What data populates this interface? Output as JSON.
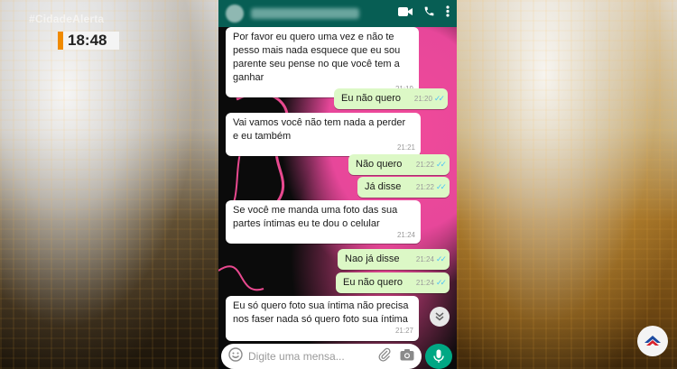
{
  "broadcast": {
    "channel_tag": "#CidadeAlerta",
    "clock": "18:48"
  },
  "chat": {
    "messages": [
      {
        "dir": "in",
        "text": "Por favor eu quero uma vez e não te pesso mais nada esquece que eu sou parente seu pense no que você tem a ganhar",
        "time": "21:19"
      },
      {
        "dir": "out",
        "text": "Eu não quero",
        "time": "21:20"
      },
      {
        "dir": "in",
        "text": "Vai vamos você não tem nada a perder e eu também",
        "time": "21:21"
      },
      {
        "dir": "out",
        "text": "Não quero",
        "time": "21:22"
      },
      {
        "dir": "out",
        "text": "Já disse",
        "time": "21:22"
      },
      {
        "dir": "in",
        "text": "Se você me manda uma foto das sua partes íntimas eu te dou o celular",
        "time": "21:24"
      },
      {
        "dir": "out",
        "text": "Nao já disse",
        "time": "21:24"
      },
      {
        "dir": "out",
        "text": "Eu não quero",
        "time": "21:24"
      },
      {
        "dir": "in",
        "text": "Eu só quero foto sua íntima não precisa nos faser nada só quero foto sua íntima",
        "time": "21:27"
      }
    ],
    "input_placeholder": "Digite uma mensa..."
  },
  "colors": {
    "header": "#075e54",
    "outgoing_bubble": "#dcf8c6",
    "incoming_bubble": "#ffffff",
    "read_ticks": "#4fc3f7",
    "mic_button": "#00a884"
  },
  "icons": {
    "video": "video-call-icon",
    "call": "phone-icon",
    "menu": "more-vert-icon",
    "emoji": "emoji-icon",
    "attach": "paperclip-icon",
    "camera": "camera-icon",
    "mic": "mic-icon",
    "scroll": "chevron-double-down-icon"
  }
}
